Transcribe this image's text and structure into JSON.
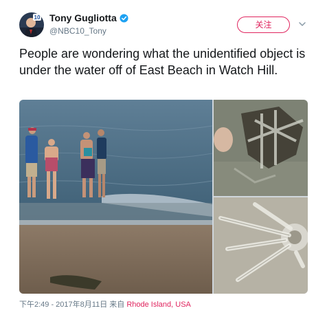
{
  "author": {
    "display_name": "Tony Gugliotta",
    "handle": "@NBC10_Tony",
    "avatar_badge": "10"
  },
  "follow_button_label": "关注",
  "tweet_text": "People are wondering what the unidentified object is under the water off of East Beach in Watch Hill.",
  "meta": {
    "timestamp": "下午2:49 - 2017年8月11日",
    "source_prefix": "来自",
    "location": "Rhode Island, USA"
  },
  "colors": {
    "accent": "#e0245e",
    "verified": "#1da1f2",
    "muted": "#657786"
  },
  "icons": [
    "verified-badge-icon",
    "chevron-down-icon"
  ]
}
